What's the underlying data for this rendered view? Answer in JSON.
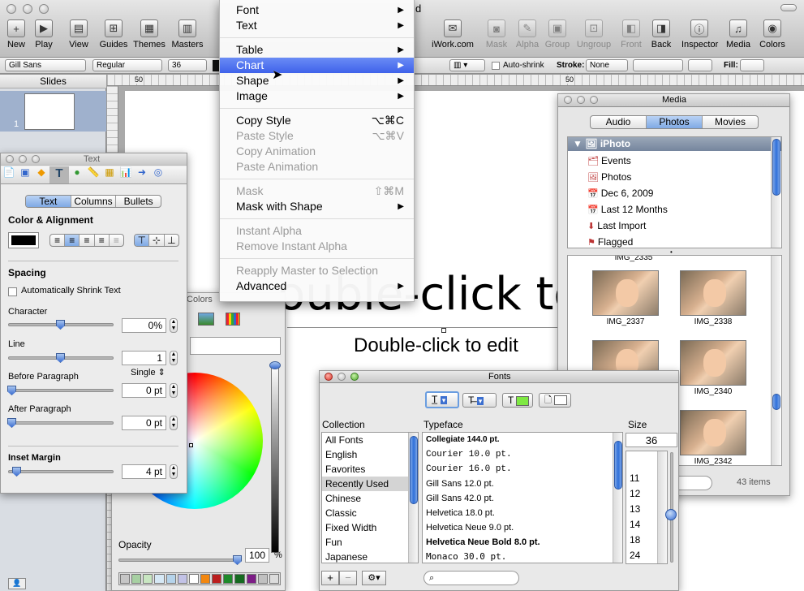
{
  "app": {
    "window_title_fragment": "d",
    "toolbar": [
      {
        "label": "New",
        "icon": "plus-icon"
      },
      {
        "label": "Play",
        "icon": "play-icon"
      },
      {
        "label": "View",
        "icon": "view-icon"
      },
      {
        "label": "Guides",
        "icon": "guides-icon"
      },
      {
        "label": "Themes",
        "icon": "themes-icon"
      },
      {
        "label": "Masters",
        "icon": "masters-icon"
      }
    ],
    "toolbar_right": [
      {
        "label": "iWork.com",
        "icon": "iwork-icon",
        "enabled": true
      },
      {
        "label": "Mask",
        "icon": "mask-icon",
        "enabled": false
      },
      {
        "label": "Alpha",
        "icon": "alpha-icon",
        "enabled": false
      },
      {
        "label": "Group",
        "icon": "group-icon",
        "enabled": false
      },
      {
        "label": "Ungroup",
        "icon": "ungroup-icon",
        "enabled": false
      },
      {
        "label": "Front",
        "icon": "front-icon",
        "enabled": false
      },
      {
        "label": "Back",
        "icon": "back-icon",
        "enabled": true
      },
      {
        "label": "Inspector",
        "icon": "inspector-icon",
        "enabled": true
      },
      {
        "label": "Media",
        "icon": "media-icon",
        "enabled": true
      },
      {
        "label": "Colors",
        "icon": "colors-icon",
        "enabled": true
      }
    ],
    "format_bar": {
      "font": "Gill Sans",
      "style": "Regular",
      "size": "36",
      "auto_shrink": "Auto-shrink",
      "stroke_label": "Stroke:",
      "stroke_value": "None",
      "fill_label": "Fill:"
    },
    "slides_panel": {
      "title": "Slides",
      "slide_number": "1"
    },
    "ruler": [
      "50",
      "50"
    ],
    "canvas": {
      "title_placeholder": "ouble-click to",
      "subtitle_placeholder": "Double-click to edit"
    }
  },
  "menu": {
    "items": [
      {
        "label": "Font",
        "submenu": true,
        "enabled": true
      },
      {
        "label": "Text",
        "submenu": true,
        "enabled": true
      },
      {
        "sep": true
      },
      {
        "label": "Table",
        "submenu": true,
        "enabled": true
      },
      {
        "label": "Chart",
        "submenu": true,
        "enabled": true,
        "selected": true
      },
      {
        "label": "Shape",
        "submenu": true,
        "enabled": true
      },
      {
        "label": "Image",
        "submenu": true,
        "enabled": true
      },
      {
        "sep": true
      },
      {
        "label": "Copy Style",
        "shortcut": "⌥⌘C",
        "enabled": true
      },
      {
        "label": "Paste Style",
        "shortcut": "⌥⌘V",
        "enabled": false
      },
      {
        "label": "Copy Animation",
        "enabled": false
      },
      {
        "label": "Paste Animation",
        "enabled": false
      },
      {
        "sep": true
      },
      {
        "label": "Mask",
        "shortcut": "⇧⌘M",
        "enabled": false
      },
      {
        "label": "Mask with Shape",
        "submenu": true,
        "enabled": true
      },
      {
        "sep": true
      },
      {
        "label": "Instant Alpha",
        "enabled": false
      },
      {
        "label": "Remove Instant Alpha",
        "enabled": false
      },
      {
        "sep": true
      },
      {
        "label": "Reapply Master to Selection",
        "enabled": false
      },
      {
        "label": "Advanced",
        "submenu": true,
        "enabled": true
      }
    ]
  },
  "text_inspector": {
    "title": "Text",
    "tabs": [
      "Text",
      "Columns",
      "Bullets"
    ],
    "color_alignment": "Color & Alignment",
    "spacing": "Spacing",
    "auto_shrink": "Automatically Shrink Text",
    "character_label": "Character",
    "character_value": "0%",
    "line_label": "Line",
    "line_value": "1",
    "line_mode": "Single",
    "before_label": "Before Paragraph",
    "before_value": "0 pt",
    "after_label": "After Paragraph",
    "after_value": "0 pt",
    "inset_label": "Inset Margin",
    "inset_value": "4 pt",
    "slider_levels": {
      "character": 0.5,
      "line": 0.5,
      "before": 0.0,
      "after": 0.0,
      "inset": 0.05
    }
  },
  "colors_panel": {
    "title_fragment": "Colors",
    "opacity_label": "Opacity",
    "opacity_value": "100",
    "opacity_unit": "%",
    "swatches": [
      "#c6c6c6",
      "#a7d0a2",
      "#c8e6c1",
      "#d6e8f5",
      "#b5d3ea",
      "#c2c2e6",
      "#ffffff",
      "#f3870f",
      "#bb1f1f",
      "#1f8a2b",
      "#166a20",
      "#7d1c86",
      "#c0c0c0",
      "#dcdcdc"
    ]
  },
  "media": {
    "title": "Media",
    "tabs": [
      "Audio",
      "Photos",
      "Movies"
    ],
    "active_tab": "Photos",
    "source_root": "iPhoto",
    "sources": [
      "Events",
      "Photos",
      "Dec 6, 2009",
      "Last 12 Months",
      "Last Import",
      "Flagged"
    ],
    "photos": [
      "IMG_2335",
      "IMG_2337",
      "IMG_2338",
      "",
      "IMG_2340",
      "",
      "IMG_2342"
    ],
    "count": "43 items"
  },
  "fonts": {
    "title": "Fonts",
    "col_collection": "Collection",
    "col_typeface": "Typeface",
    "col_size": "Size",
    "collections": [
      "All Fonts",
      "English",
      "Favorites",
      "Recently Used",
      "Chinese",
      "Classic",
      "Fixed Width",
      "Fun",
      "Japanese"
    ],
    "selected_collection": "Recently Used",
    "typefaces": [
      "Collegiate 144.0 pt.",
      "Courier 10.0 pt.",
      "Courier 16.0 pt.",
      "Gill Sans 12.0 pt.",
      "Gill Sans 42.0 pt.",
      "Helvetica 18.0 pt.",
      "Helvetica Neue 9.0 pt.",
      "Helvetica Neue Bold 8.0 pt.",
      "Monaco 30.0 pt."
    ],
    "size_value": "36",
    "sizes": [
      "11",
      "12",
      "13",
      "14",
      "18",
      "24",
      "36"
    ],
    "text_color": "#7ee842"
  }
}
